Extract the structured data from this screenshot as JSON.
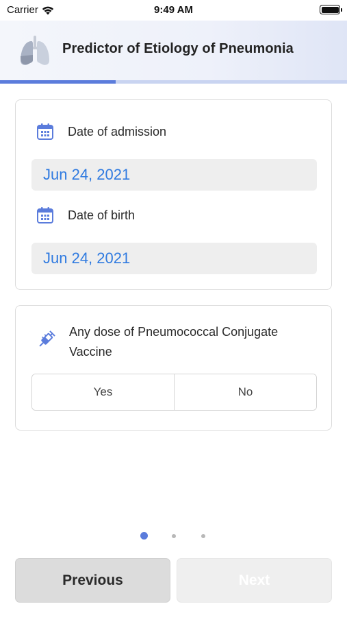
{
  "status_bar": {
    "carrier": "Carrier",
    "time": "9:49 AM"
  },
  "header": {
    "title": "Predictor of Etiology of Pneumonia",
    "logo_icon": "lungs-icon"
  },
  "progress": {
    "fraction": 0.333
  },
  "dates_card": {
    "admission": {
      "label": "Date of admission",
      "value": "Jun 24, 2021",
      "icon": "calendar-icon"
    },
    "birth": {
      "label": "Date of birth",
      "value": "Jun 24, 2021",
      "icon": "calendar-icon"
    }
  },
  "vaccine_card": {
    "label": "Any dose of Pneumococcal Conjugate Vaccine",
    "icon": "syringe-icon",
    "options": [
      "Yes",
      "No"
    ]
  },
  "pager": {
    "current_page": 1,
    "total_pages": 3
  },
  "footer": {
    "previous_label": "Previous",
    "next_label": "Next"
  },
  "colors": {
    "accent": "#5b7cdc",
    "date_text": "#2f7ae0",
    "progress_track": "#c9d4f1"
  }
}
